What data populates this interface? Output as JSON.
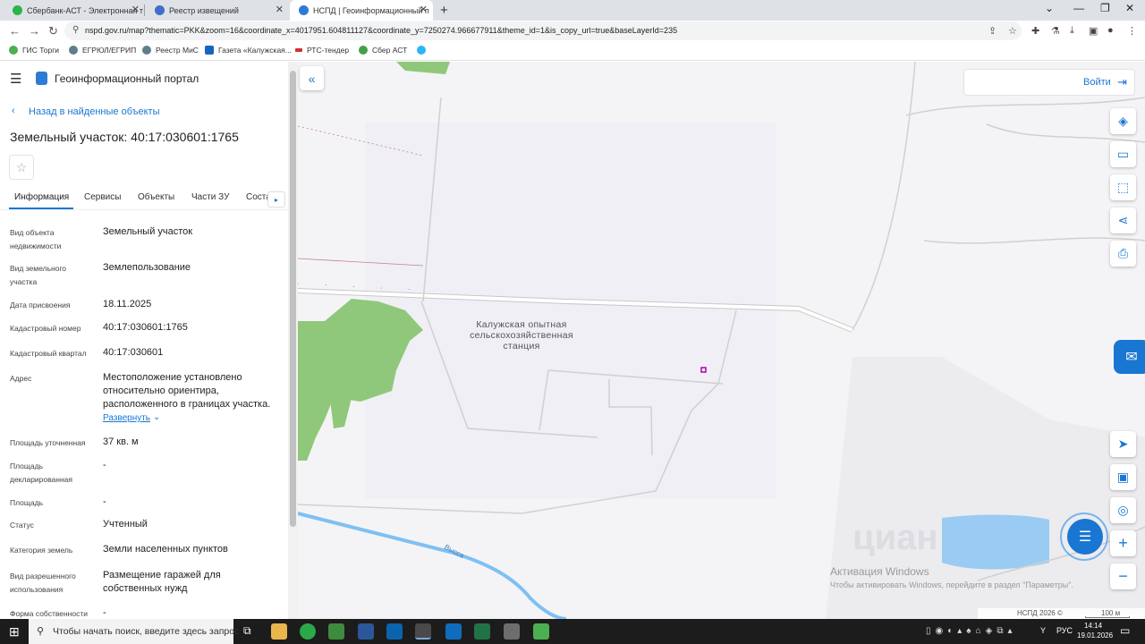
{
  "browser": {
    "tabs": [
      {
        "label": "Сбербанк-АСТ - Электронная т",
        "fav_color": "#2db34a"
      },
      {
        "label": "Реестр извещений",
        "fav_color": "#3f6fc9"
      },
      {
        "label": "НСПД | Геоинформационный п",
        "fav_color": "#2e7bd6"
      }
    ],
    "new_tab": "+",
    "url": "nspd.gov.ru/map?thematic=PKK&zoom=16&coordinate_x=4017951.604811127&coordinate_y=7250274.966677911&theme_id=1&is_copy_url=true&baseLayerId=235",
    "bookmarks": [
      {
        "label": "ГИС Торги",
        "color": "#4caf50"
      },
      {
        "label": "ЕГРЮЛ/ЕГРИП",
        "color": "#607d8b"
      },
      {
        "label": "Реестр МиС",
        "color": "#607d8b"
      },
      {
        "label": "Газета «Калужская...",
        "color": "#1565c0"
      },
      {
        "label": "РТС-тендер",
        "color": "#d32f2f"
      },
      {
        "label": "Сбер АСТ",
        "color": "#43a047"
      }
    ]
  },
  "portal": {
    "title": "Геоинформационный портал",
    "back_link": "Назад в найденные объекты",
    "object_title": "Земельный участок: 40:17:030601:1765",
    "tabs": [
      "Информация",
      "Сервисы",
      "Объекты",
      "Части ЗУ",
      "Соста"
    ],
    "active_tab": "Информация",
    "fields": [
      {
        "label": "Вид объекта недвижимости",
        "value": "Земельный участок"
      },
      {
        "label": "Вид земельного участка",
        "value": "Землепользование"
      },
      {
        "label": "Дата присвоения",
        "value": "18.11.2025"
      },
      {
        "label": "Кадастровый номер",
        "value": "40:17:030601:1765"
      },
      {
        "label": "Кадастровый квартал",
        "value": "40:17:030601"
      },
      {
        "label": "Адрес",
        "value": "Местоположение установлено относительно ориентира, расположенного в границах участка."
      },
      {
        "label": "Площадь уточненная",
        "value": "37 кв. м"
      },
      {
        "label": "Площадь декларированная",
        "value": "-"
      },
      {
        "label": "Площадь",
        "value": "-"
      },
      {
        "label": "Статус",
        "value": "Учтенный"
      },
      {
        "label": "Категория земель",
        "value": "Земли населенных пунктов"
      },
      {
        "label": "Вид разрешенного использования",
        "value": "Размещение гаражей для собственных нужд"
      },
      {
        "label": "Форма собственности",
        "value": "-"
      }
    ],
    "expand_link": "Развернуть",
    "login": "Войти"
  },
  "map": {
    "place_label": "Калужская опытная сельскохозяйственная станция",
    "river_label": "Высса",
    "watermark_title": "Активация Windows",
    "watermark_sub": "Чтобы активировать Windows, перейдите в раздел \"Параметры\".",
    "copyright": "НСПД 2026 ©",
    "scale": "100 м",
    "cian": "циан"
  },
  "taskbar": {
    "search": "Чтобы начать поиск, введите здесь запрос",
    "lang": "РУС",
    "time": "14:14",
    "date": "19.01.2026"
  },
  "colors": {
    "accent": "#1976d2",
    "green_area": "#8fc87a",
    "water": "#6ab7f0"
  }
}
